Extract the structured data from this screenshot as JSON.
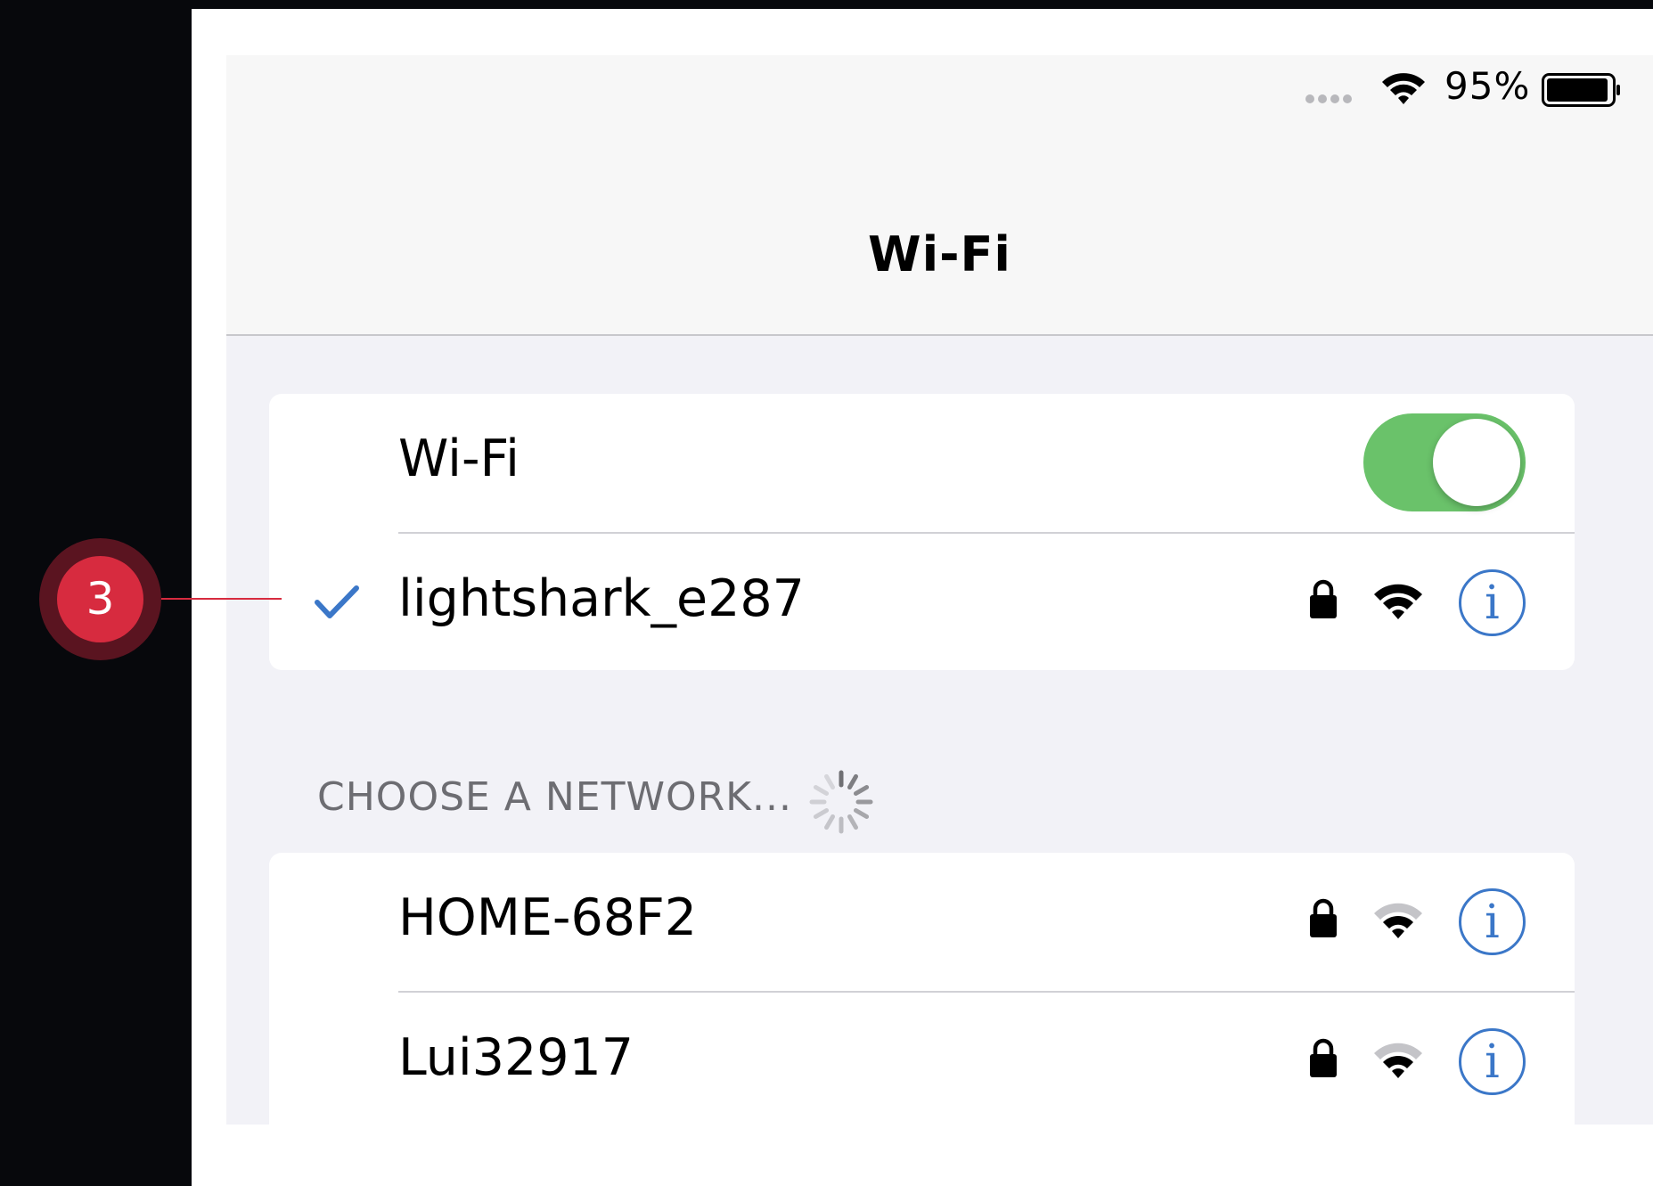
{
  "status_bar": {
    "battery_percent": "95%"
  },
  "nav": {
    "title": "Wi-Fi"
  },
  "wifi_toggle": {
    "label": "Wi-Fi",
    "on": true
  },
  "connected_network": {
    "name": "lightshark_e287",
    "secured": true,
    "signal_bars": 3
  },
  "section": {
    "header": "CHOOSE A NETWORK..."
  },
  "networks": [
    {
      "name": "HOME-68F2",
      "secured": true,
      "signal_bars": 2
    },
    {
      "name": "Lui32917",
      "secured": true,
      "signal_bars": 2
    }
  ],
  "callout": {
    "number": "3"
  },
  "colors": {
    "accent_blue": "#3b77c8",
    "toggle_green": "#6ac26a",
    "callout_red": "#d72b3f"
  }
}
